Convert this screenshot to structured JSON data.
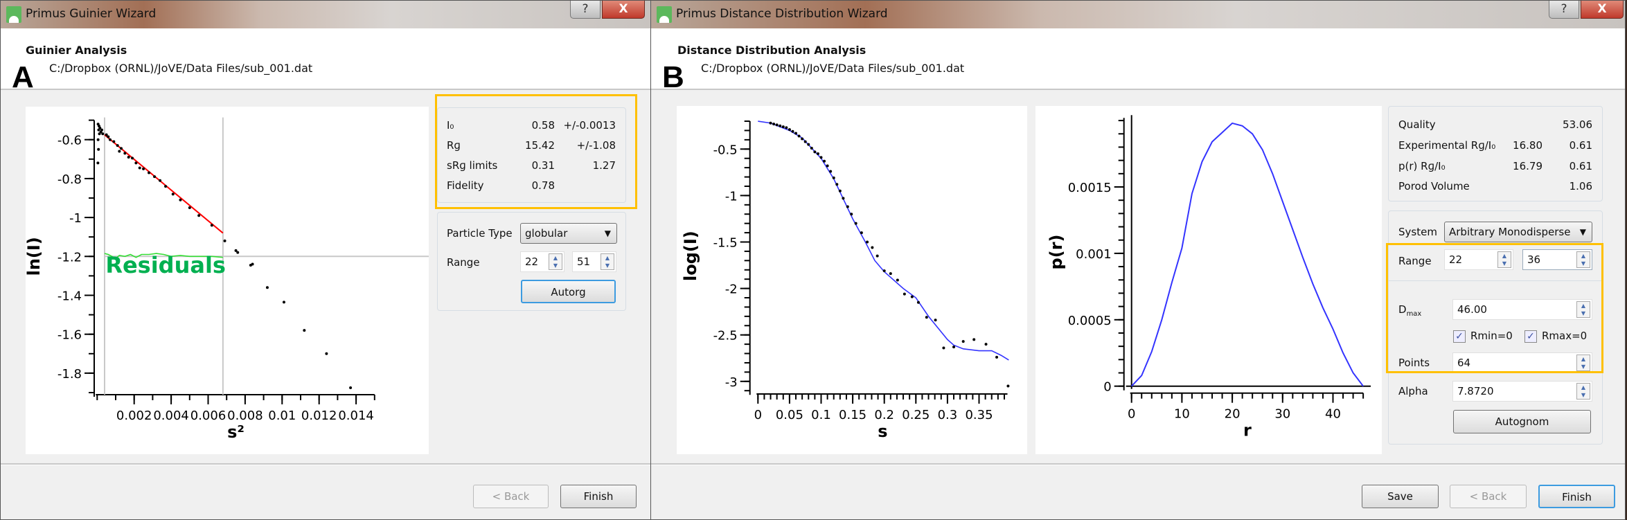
{
  "left": {
    "title": "Primus Guinier Wizard",
    "help_label": "?",
    "close_label": "X",
    "heading": "Guinier Analysis",
    "panel_letter": "A",
    "file_path": "C:/Dropbox (ORNL)/JoVE/Data Files/sub_001.dat",
    "results": [
      {
        "label": "I₀",
        "value": "0.58",
        "error": "+/-0.0013"
      },
      {
        "label": "Rɡ",
        "value": "15.42",
        "error": "+/-1.08"
      },
      {
        "label": "sRɡ limits",
        "value": "0.31",
        "error": "1.27"
      },
      {
        "label": "Fidelity",
        "value": "0.78",
        "error": ""
      }
    ],
    "particle_type_label": "Particle Type",
    "particle_type_value": "globular",
    "range_label": "Range",
    "range_start": "22",
    "range_end": "51",
    "autorg_label": "Autorg",
    "back_label": "< Back",
    "finish_label": "Finish",
    "annotation": "Residuals"
  },
  "right": {
    "title": "Primus Distance Distribution Wizard",
    "help_label": "?",
    "close_label": "X",
    "heading": "Distance Distribution Analysis",
    "panel_letter": "B",
    "file_path": "C:/Dropbox (ORNL)/JoVE/Data Files/sub_001.dat",
    "quality_label": "Quality",
    "quality_value": "53.06",
    "exp_label": "Experimental Rɡ/I₀",
    "exp_rg": "16.80",
    "exp_i0": "0.61",
    "pr_label": "p(r) Rɡ/I₀",
    "pr_rg": "16.79",
    "pr_i0": "0.61",
    "porod_label": "Porod Volume",
    "porod_value": "1.06",
    "system_label": "System",
    "system_value": "Arbitrary Monodisperse",
    "range_label": "Range",
    "range_start": "22",
    "range_end": "36",
    "dmax_label": "D",
    "dmax_sub": "max",
    "dmax_value": "46.00",
    "rmin_label": "Rmin=0",
    "rmin_checked": true,
    "rmax_label": "Rmax=0",
    "rmax_checked": true,
    "points_label": "Points",
    "points_value": "64",
    "alpha_label": "Alpha",
    "alpha_value": "7.8720",
    "autognom_label": "Autognom",
    "save_label": "Save",
    "back_label": "< Back",
    "finish_label": "Finish"
  },
  "colors": {
    "highlight": "#ffc000",
    "fit": "#ff0000",
    "residuals": "#00b050",
    "model": "#3333ff"
  },
  "chart_data": [
    {
      "type": "scatter",
      "title": "Guinier plot",
      "xlabel": "s²",
      "ylabel": "ln(I)",
      "xlim": [
        0,
        0.015
      ],
      "ylim": [
        -1.9,
        -0.5
      ],
      "xticks": [
        "0.002",
        "0.004",
        "0.006",
        "0.008",
        "0.01",
        "0.012",
        "0.014"
      ],
      "xtick_values": [
        0.002,
        0.004,
        0.006,
        0.008,
        0.01,
        0.012,
        0.014
      ],
      "yticks": [
        "-0.6",
        "-0.8",
        "-1",
        "-1.2",
        "-1.4",
        "-1.6",
        "-1.8"
      ],
      "ytick_values": [
        -0.6,
        -0.8,
        -1,
        -1.2,
        -1.4,
        -1.6,
        -1.8
      ],
      "range_markers_x": [
        0.0004,
        0.0068
      ],
      "residual_baseline_y": -1.2,
      "points": [
        [
          5e-05,
          -0.52
        ],
        [
          0.0001,
          -0.53
        ],
        [
          8e-05,
          -0.55
        ],
        [
          0.00015,
          -0.54
        ],
        [
          0.0002,
          -0.56
        ],
        [
          0.00012,
          -0.57
        ],
        [
          5e-05,
          -0.6
        ],
        [
          7e-05,
          -0.65
        ],
        [
          4e-05,
          -0.72
        ],
        [
          0.00025,
          -0.55
        ],
        [
          0.0003,
          -0.57
        ],
        [
          0.0005,
          -0.575
        ],
        [
          0.0006,
          -0.585
        ],
        [
          0.0007,
          -0.6
        ],
        [
          0.0009,
          -0.61
        ],
        [
          0.0011,
          -0.63
        ],
        [
          0.0012,
          -0.66
        ],
        [
          0.0013,
          -0.645
        ],
        [
          0.0015,
          -0.67
        ],
        [
          0.0017,
          -0.69
        ],
        [
          0.0019,
          -0.695
        ],
        [
          0.0021,
          -0.72
        ],
        [
          0.0023,
          -0.745
        ],
        [
          0.0025,
          -0.75
        ],
        [
          0.0028,
          -0.77
        ],
        [
          0.0031,
          -0.79
        ],
        [
          0.0034,
          -0.81
        ],
        [
          0.0037,
          -0.84
        ],
        [
          0.0041,
          -0.88
        ],
        [
          0.0045,
          -0.91
        ],
        [
          0.005,
          -0.95
        ],
        [
          0.0055,
          -0.99
        ],
        [
          0.0062,
          -1.04
        ],
        [
          0.0069,
          -1.12
        ],
        [
          0.0075,
          -1.17
        ],
        [
          0.0076,
          -1.18
        ],
        [
          0.0083,
          -1.245
        ],
        [
          0.0084,
          -1.24
        ],
        [
          0.0092,
          -1.36
        ],
        [
          0.0101,
          -1.435
        ],
        [
          0.0112,
          -1.58
        ],
        [
          0.0124,
          -1.7
        ],
        [
          0.0137,
          -1.875
        ]
      ],
      "fit_line": [
        [
          0.0004,
          -0.575
        ],
        [
          0.0068,
          -1.08
        ]
      ],
      "residuals": [
        [
          0.0004,
          -1.185
        ],
        [
          0.0006,
          -1.19
        ],
        [
          0.0008,
          -1.2
        ],
        [
          0.001,
          -1.21
        ],
        [
          0.0012,
          -1.195
        ],
        [
          0.0015,
          -1.2
        ],
        [
          0.0018,
          -1.19
        ],
        [
          0.0021,
          -1.205
        ],
        [
          0.0024,
          -1.19
        ],
        [
          0.0028,
          -1.19
        ],
        [
          0.0032,
          -1.185
        ],
        [
          0.0036,
          -1.19
        ],
        [
          0.004,
          -1.2
        ],
        [
          0.0045,
          -1.195
        ],
        [
          0.005,
          -1.2
        ],
        [
          0.0056,
          -1.2
        ],
        [
          0.0062,
          -1.2
        ],
        [
          0.0068,
          -1.205
        ]
      ]
    },
    {
      "type": "line",
      "title": "Experimental intensity and fit",
      "xlabel": "s",
      "ylabel": "log(I)",
      "xlim": [
        0,
        0.395
      ],
      "ylim": [
        -3.1,
        -0.2
      ],
      "xticks": [
        "0",
        "0.05",
        "0.1",
        "0.15",
        "0.2",
        "0.25",
        "0.3",
        "0.35"
      ],
      "xtick_values": [
        0,
        0.05,
        0.1,
        0.15,
        0.2,
        0.25,
        0.3,
        0.35
      ],
      "yticks": [
        "-0.5",
        "-1",
        "-1.5",
        "-2",
        "-2.5",
        "-3"
      ],
      "ytick_values": [
        -0.5,
        -1,
        -1.5,
        -2,
        -2.5,
        -3
      ],
      "points": [
        [
          0.02,
          -0.22
        ],
        [
          0.025,
          -0.23
        ],
        [
          0.03,
          -0.24
        ],
        [
          0.035,
          -0.25
        ],
        [
          0.04,
          -0.26
        ],
        [
          0.045,
          -0.27
        ],
        [
          0.05,
          -0.29
        ],
        [
          0.055,
          -0.31
        ],
        [
          0.06,
          -0.33
        ],
        [
          0.065,
          -0.36
        ],
        [
          0.07,
          -0.39
        ],
        [
          0.075,
          -0.42
        ],
        [
          0.08,
          -0.45
        ],
        [
          0.085,
          -0.49
        ],
        [
          0.09,
          -0.53
        ],
        [
          0.095,
          -0.55
        ],
        [
          0.1,
          -0.59
        ],
        [
          0.105,
          -0.63
        ],
        [
          0.11,
          -0.68
        ],
        [
          0.115,
          -0.74
        ],
        [
          0.12,
          -0.81
        ],
        [
          0.125,
          -0.88
        ],
        [
          0.13,
          -0.95
        ],
        [
          0.135,
          -1.03
        ],
        [
          0.142,
          -1.12
        ],
        [
          0.148,
          -1.2
        ],
        [
          0.155,
          -1.3
        ],
        [
          0.164,
          -1.4
        ],
        [
          0.173,
          -1.5
        ],
        [
          0.181,
          -1.56
        ],
        [
          0.189,
          -1.65
        ],
        [
          0.2,
          -1.81
        ],
        [
          0.21,
          -1.84
        ],
        [
          0.221,
          -1.91
        ],
        [
          0.232,
          -2.06
        ],
        [
          0.244,
          -2.09
        ],
        [
          0.254,
          -2.15
        ],
        [
          0.267,
          -2.31
        ],
        [
          0.281,
          -2.34
        ],
        [
          0.294,
          -2.64
        ],
        [
          0.31,
          -2.63
        ],
        [
          0.325,
          -2.57
        ],
        [
          0.342,
          -2.55
        ],
        [
          0.361,
          -2.6
        ],
        [
          0.378,
          -2.74
        ],
        [
          0.396,
          -3.05
        ]
      ],
      "fit": [
        [
          0,
          -0.2
        ],
        [
          0.02,
          -0.22
        ],
        [
          0.05,
          -0.3
        ],
        [
          0.07,
          -0.38
        ],
        [
          0.1,
          -0.6
        ],
        [
          0.12,
          -0.82
        ],
        [
          0.15,
          -1.25
        ],
        [
          0.17,
          -1.5
        ],
        [
          0.185,
          -1.7
        ],
        [
          0.2,
          -1.82
        ],
        [
          0.23,
          -2.0
        ],
        [
          0.25,
          -2.1
        ],
        [
          0.27,
          -2.3
        ],
        [
          0.3,
          -2.55
        ],
        [
          0.31,
          -2.61
        ],
        [
          0.325,
          -2.65
        ],
        [
          0.35,
          -2.67
        ],
        [
          0.37,
          -2.67
        ],
        [
          0.385,
          -2.72
        ],
        [
          0.397,
          -2.77
        ]
      ]
    },
    {
      "type": "line",
      "title": "Pair distance distribution",
      "xlabel": "r",
      "ylabel": "p(r)",
      "xlim": [
        0,
        46
      ],
      "ylim": [
        0,
        0.00202
      ],
      "xticks": [
        "0",
        "10",
        "20",
        "30",
        "40"
      ],
      "xtick_values": [
        0,
        10,
        20,
        30,
        40
      ],
      "yticks": [
        "0",
        "0.0005",
        "0.001",
        "0.0015"
      ],
      "ytick_values": [
        0,
        0.0005,
        0.001,
        0.0015
      ],
      "pr": [
        [
          0,
          0
        ],
        [
          2,
          8e-05
        ],
        [
          4,
          0.00026
        ],
        [
          6,
          0.0005
        ],
        [
          8,
          0.00078
        ],
        [
          10,
          0.00104
        ],
        [
          12,
          0.00145
        ],
        [
          14,
          0.00169
        ],
        [
          16,
          0.00184
        ],
        [
          18,
          0.00191
        ],
        [
          20,
          0.00198
        ],
        [
          22,
          0.00196
        ],
        [
          24,
          0.0019
        ],
        [
          26,
          0.00178
        ],
        [
          28,
          0.0016
        ],
        [
          30,
          0.00139
        ],
        [
          32,
          0.00118
        ],
        [
          34,
          0.00097
        ],
        [
          36,
          0.00077
        ],
        [
          38,
          0.00059
        ],
        [
          40,
          0.00043
        ],
        [
          42,
          0.00025
        ],
        [
          44,
          0.0001
        ],
        [
          46,
          0
        ]
      ]
    }
  ]
}
